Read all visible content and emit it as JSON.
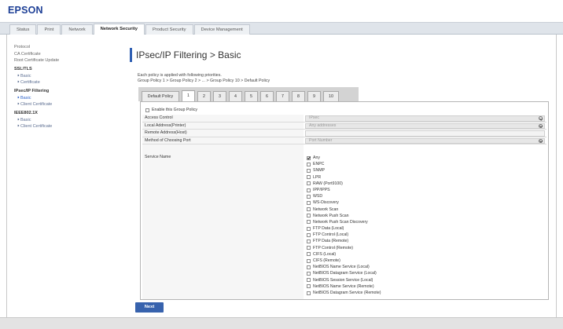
{
  "brand": {
    "logo": "EPSON"
  },
  "nav": {
    "tabs": [
      {
        "label": "Status",
        "active": false
      },
      {
        "label": "Print",
        "active": false
      },
      {
        "label": "Network",
        "active": false
      },
      {
        "label": "Network Security",
        "active": true
      },
      {
        "label": "Product Security",
        "active": false
      },
      {
        "label": "Device Management",
        "active": false
      }
    ]
  },
  "sidebar": {
    "items": [
      {
        "label": "Protocol"
      },
      {
        "label": "CA Certificate"
      },
      {
        "label": "Root Certificate Update"
      },
      {
        "label": "SSL/TLS"
      },
      {
        "label": "Basic"
      },
      {
        "label": "Certificate"
      },
      {
        "label": "IPsec/IP Filtering"
      },
      {
        "label": "Basic",
        "active": true
      },
      {
        "label": "Client Certificate"
      },
      {
        "label": "IEEE802.1X"
      },
      {
        "label": "Basic"
      },
      {
        "label": "Client Certificate"
      }
    ]
  },
  "page": {
    "title": "IPsec/IP Filtering > Basic",
    "priority_note": "Each policy is applied with following priorities.",
    "priority_order": "Group Policy 1 > Group Policy 2 > ... > Group Policy 10 > Default Policy"
  },
  "policy_tabs": [
    {
      "label": "Default Policy",
      "active": false
    },
    {
      "label": "1",
      "active": true
    },
    {
      "label": "2",
      "active": false
    },
    {
      "label": "3",
      "active": false
    },
    {
      "label": "4",
      "active": false
    },
    {
      "label": "5",
      "active": false
    },
    {
      "label": "6",
      "active": false
    },
    {
      "label": "7",
      "active": false
    },
    {
      "label": "8",
      "active": false
    },
    {
      "label": "9",
      "active": false
    },
    {
      "label": "10",
      "active": false
    }
  ],
  "form": {
    "enable_group_policy": {
      "label": "Enable this Group Policy",
      "checked": false
    },
    "access_control": {
      "label": "Access Control",
      "value": "IPsec"
    },
    "local_address": {
      "label": "Local Address(Printer)",
      "value": "Any addresses"
    },
    "remote_address": {
      "label": "Remote Address(Host)",
      "value": ""
    },
    "port_method": {
      "label": "Method of Choosing Port",
      "value": "Port Number"
    },
    "service_name": {
      "label": "Service Name",
      "options": [
        {
          "label": "Any",
          "checked": true
        },
        {
          "label": "ENPC",
          "checked": false
        },
        {
          "label": "SNMP",
          "checked": false
        },
        {
          "label": "LPR",
          "checked": false
        },
        {
          "label": "RAW (Port9100)",
          "checked": false
        },
        {
          "label": "IPP/IPPS",
          "checked": false
        },
        {
          "label": "WSD",
          "checked": false
        },
        {
          "label": "WS-Discovery",
          "checked": false
        },
        {
          "label": "Network Scan",
          "checked": false
        },
        {
          "label": "Network Push Scan",
          "checked": false
        },
        {
          "label": "Network Push Scan Discovery",
          "checked": false
        },
        {
          "label": "FTP Data (Local)",
          "checked": false
        },
        {
          "label": "FTP Control (Local)",
          "checked": false
        },
        {
          "label": "FTP Data (Remote)",
          "checked": false
        },
        {
          "label": "FTP Control (Remote)",
          "checked": false
        },
        {
          "label": "CIFS (Local)",
          "checked": false
        },
        {
          "label": "CIFS (Remote)",
          "checked": false
        },
        {
          "label": "NetBIOS Name Service (Local)",
          "checked": false
        },
        {
          "label": "NetBIOS Datagram Service (Local)",
          "checked": false
        },
        {
          "label": "NetBIOS Session Service (Local)",
          "checked": false
        },
        {
          "label": "NetBIOS Name Service (Remote)",
          "checked": false
        },
        {
          "label": "NetBIOS Datagram Service (Remote)",
          "checked": false
        }
      ]
    }
  },
  "actions": {
    "next_label": "Next"
  },
  "icons": {
    "sub_item": "chevron-right-icon",
    "dropdown": "chevron-down-icon"
  },
  "colors": {
    "brand": "#1d3f96",
    "accent": "#2f5fb3",
    "active_link": "#2d62c8",
    "button": "#3762ad"
  }
}
